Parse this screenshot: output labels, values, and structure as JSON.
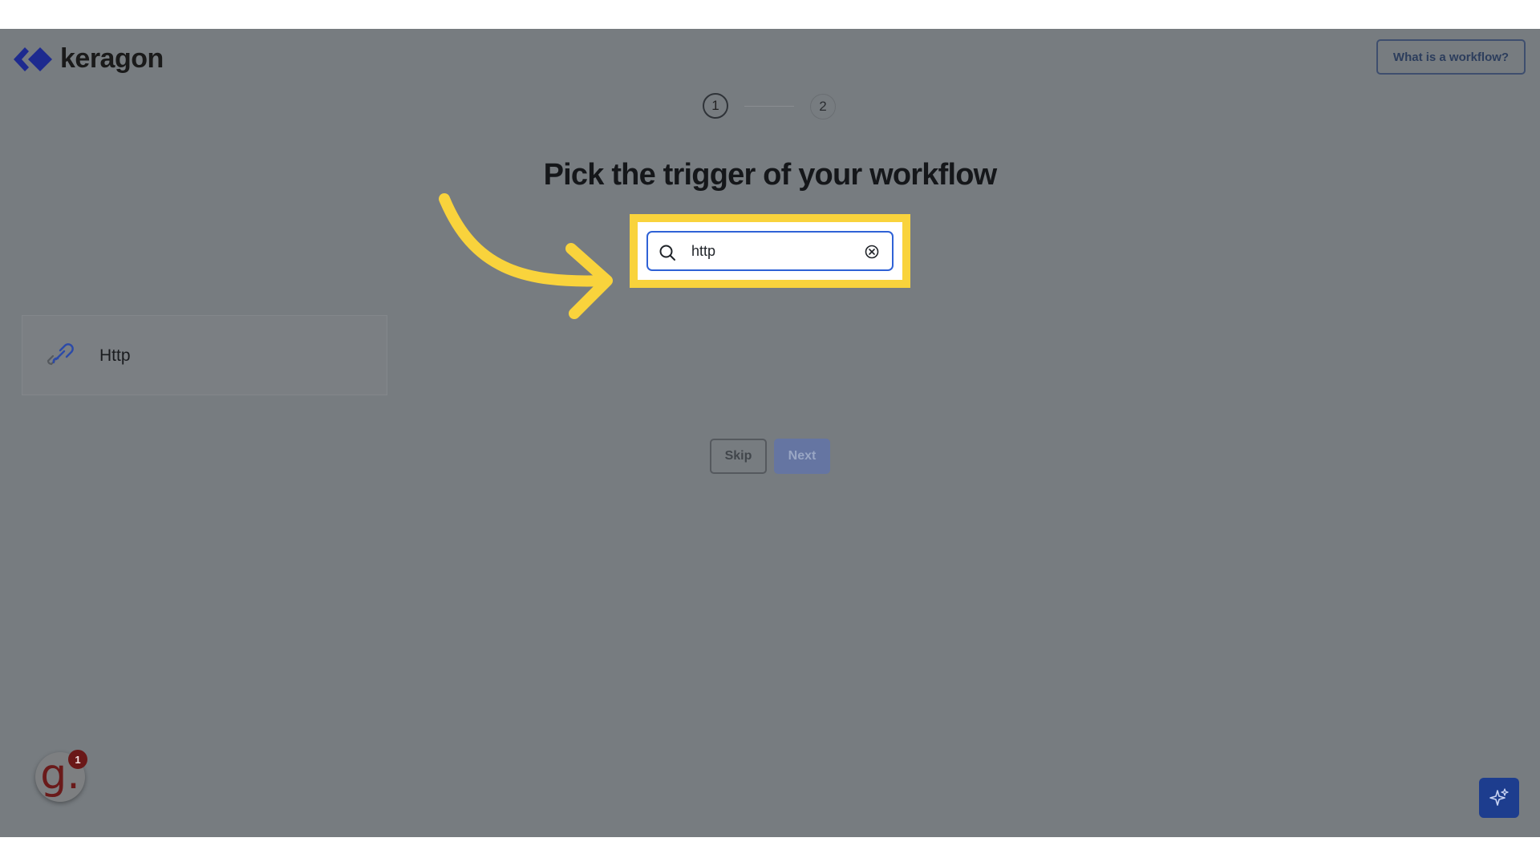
{
  "header": {
    "logo_text": "keragon",
    "help_button_label": "What is a workflow?"
  },
  "steps": {
    "step1": "1",
    "step2": "2",
    "current": 1
  },
  "main": {
    "title": "Pick the trigger of your workflow",
    "search": {
      "value": "http"
    }
  },
  "results": [
    {
      "label": "Http",
      "icon": "link-icon"
    }
  ],
  "actions": {
    "skip_label": "Skip",
    "next_label": "Next"
  },
  "widgets": {
    "avatar_letter": "g.",
    "notification_count": "1",
    "ai_button_icon": "sparkles-icon"
  },
  "colors": {
    "accent": "#1d3d8e",
    "highlight": "#f9d33c",
    "overlay": "#777c80"
  }
}
